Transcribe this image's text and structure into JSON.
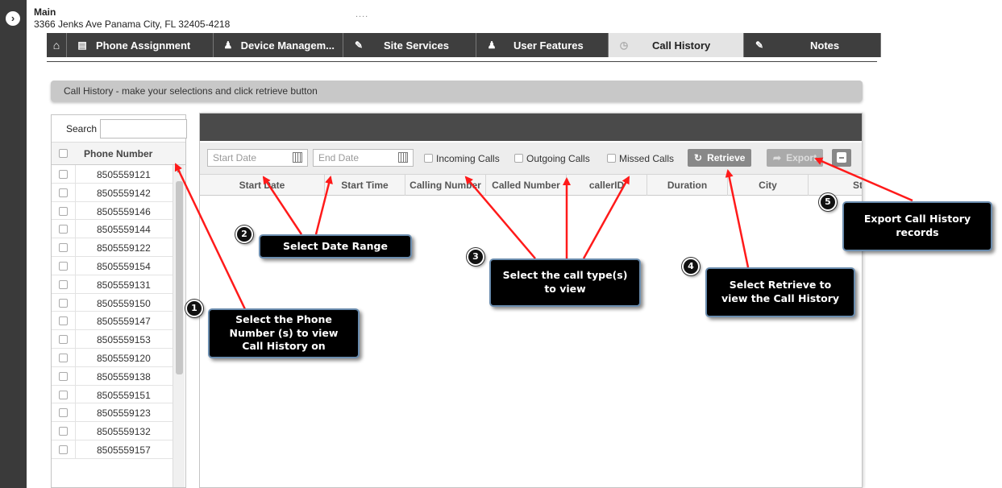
{
  "header": {
    "site_title": "Main",
    "site_address": "3366 Jenks Ave Panama City, FL 32405-4218",
    "ellipsis": "....",
    "expand_icon": "›"
  },
  "tabs": [
    {
      "label": "",
      "icon": "home-icon",
      "glyph": "⌂"
    },
    {
      "label": "Phone Assignment",
      "icon": "list-icon",
      "glyph": "▤"
    },
    {
      "label": "Device Managem...",
      "icon": "bell-icon",
      "glyph": "♟"
    },
    {
      "label": "Site Services",
      "icon": "edit-icon",
      "glyph": "✎"
    },
    {
      "label": "User Features",
      "icon": "user-icon",
      "glyph": "♟"
    },
    {
      "label": "Call History",
      "icon": "clock-icon",
      "glyph": "◷",
      "active": true
    },
    {
      "label": "Notes",
      "icon": "pencil-icon",
      "glyph": "✎"
    }
  ],
  "instruction": "Call History - make your selections and click retrieve button",
  "phone_list": {
    "search_label": "Search",
    "search_value": "",
    "header": "Phone Number",
    "numbers": [
      "8505559121",
      "8505559142",
      "8505559146",
      "8505559144",
      "8505559122",
      "8505559154",
      "8505559131",
      "8505559150",
      "8505559147",
      "8505559153",
      "8505559120",
      "8505559138",
      "8505559151",
      "8505559123",
      "8505559132",
      "8505559157"
    ]
  },
  "toolbar": {
    "start_date_placeholder": "Start Date",
    "end_date_placeholder": "End Date",
    "incoming_label": "Incoming Calls",
    "outgoing_label": "Outgoing Calls",
    "missed_label": "Missed Calls",
    "retrieve_label": "Retrieve",
    "retrieve_glyph": "↻",
    "export_label": "Export",
    "export_glyph": "➦"
  },
  "columns": [
    "Start Date",
    "Start Time",
    "Calling Number",
    "Called Number",
    "callerID",
    "Duration",
    "City",
    "State"
  ],
  "callouts": {
    "c1": {
      "num": "1",
      "text": "Select the Phone\nNumber (s) to view\nCall History on"
    },
    "c2": {
      "num": "2",
      "text": "Select Date Range"
    },
    "c3": {
      "num": "3",
      "text": "Select the call type(s)\nto view"
    },
    "c4": {
      "num": "4",
      "text": "Select Retrieve to\nview the Call History"
    },
    "c5": {
      "num": "5",
      "text": "Export Call History\nrecords"
    }
  },
  "colors": {
    "arrow": "#ff1a1a",
    "tab_bg": "#3e3e3e",
    "callout_bg": "#000000"
  }
}
